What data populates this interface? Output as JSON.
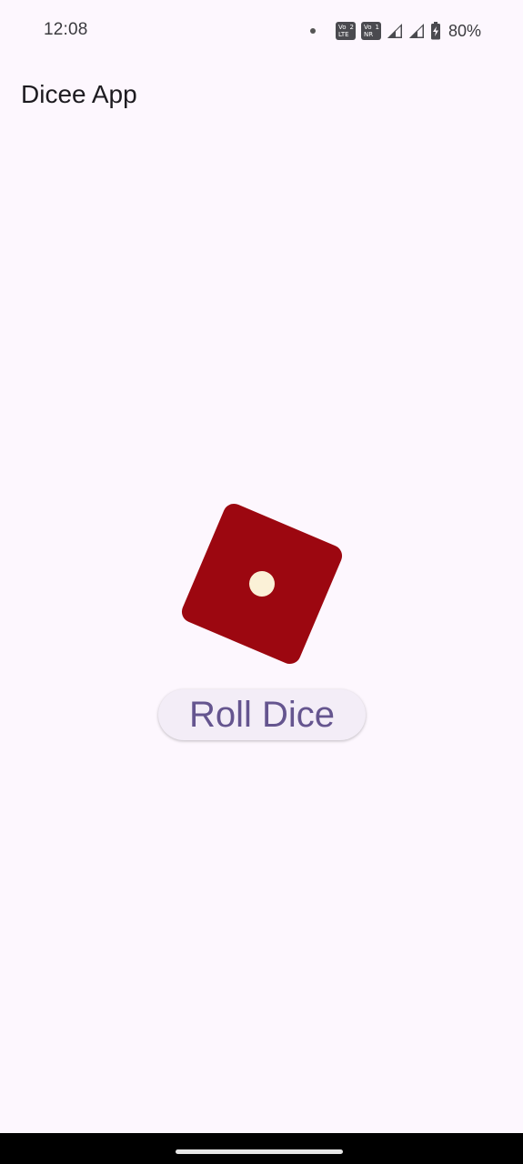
{
  "status_bar": {
    "time": "12:08",
    "sim1_top": "Vo",
    "sim1_sub": "LTE",
    "sim1_num": "2",
    "sim2_top": "Vo",
    "sim2_sub": "NR",
    "sim2_num": "1",
    "battery_percent": "80%",
    "icons": [
      "notification-dot-icon",
      "volte-icon",
      "vonr-icon",
      "signal-icon",
      "signal-icon",
      "battery-charging-icon"
    ]
  },
  "app_bar": {
    "title": "Dicee App"
  },
  "dice": {
    "face_value": 1,
    "color": "#9C0710",
    "pip_color": "#FBF1D7"
  },
  "actions": {
    "roll_label": "Roll Dice"
  },
  "colors": {
    "background": "#FDF7FE",
    "button_text": "#65558F",
    "button_bg": "#F3EDF7"
  }
}
